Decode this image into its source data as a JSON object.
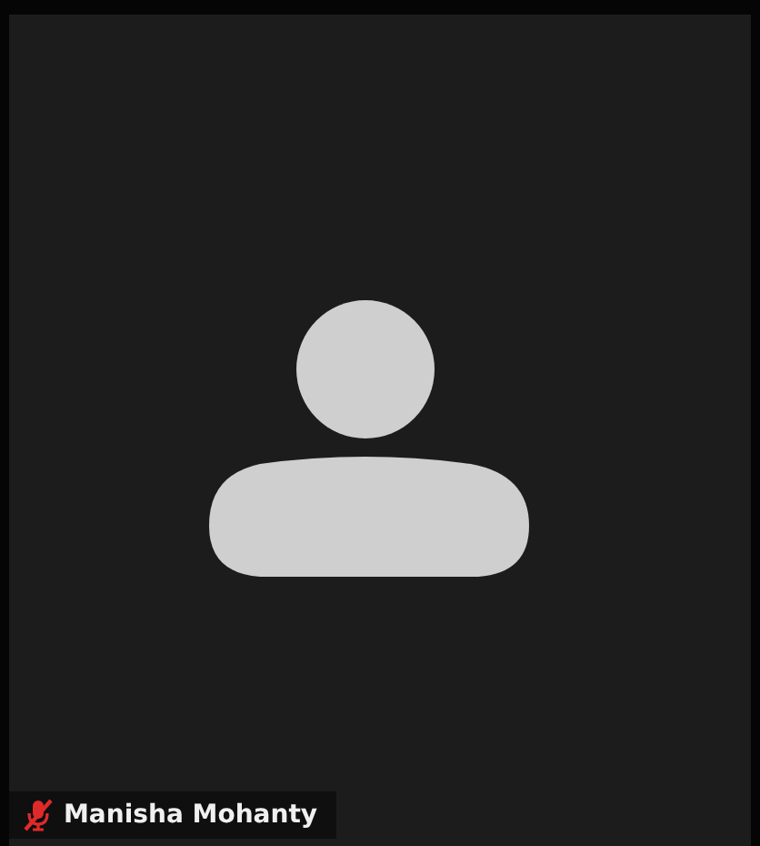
{
  "participant": {
    "name": "Manisha Mohanty",
    "muted": true
  }
}
